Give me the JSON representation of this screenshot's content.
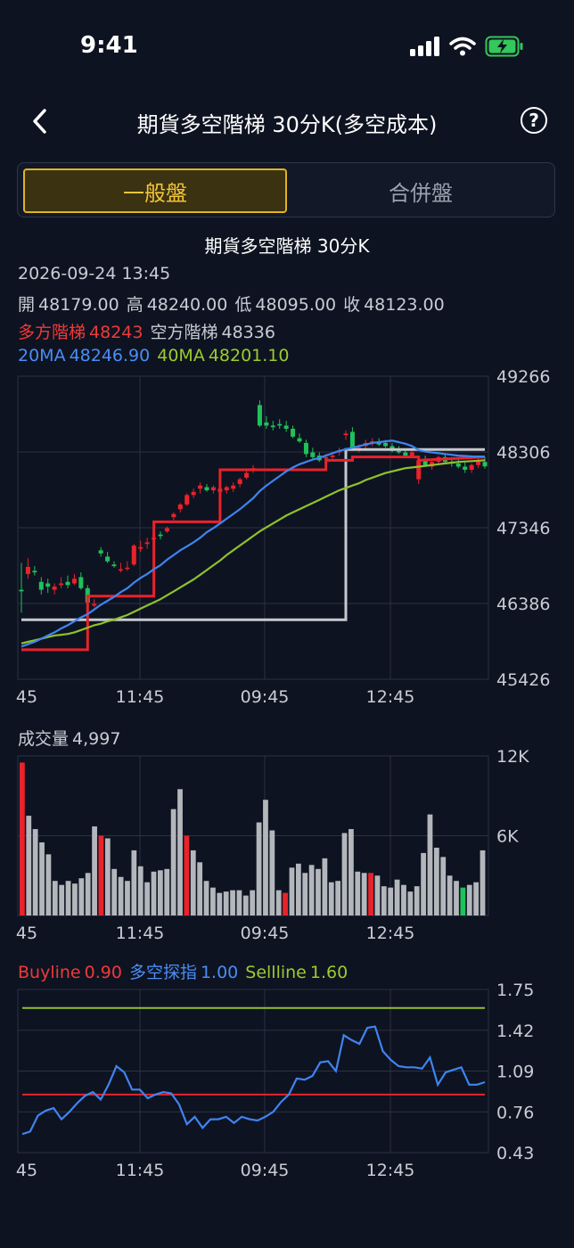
{
  "status": {
    "time": "9:41"
  },
  "nav": {
    "title": "期貨多空階梯 30分K(多空成本)",
    "help": "?"
  },
  "tabs": [
    {
      "label": "一般盤",
      "active": true
    },
    {
      "label": "合併盤",
      "active": false
    }
  ],
  "chart_title": "期貨多空階梯 30分K",
  "info": {
    "datetime": "2026-09-24 13:45",
    "open_label": "開",
    "open": "48179.00",
    "high_label": "高",
    "high": "48240.00",
    "low_label": "低",
    "low": "48095.00",
    "close_label": "收",
    "close": "48123.00",
    "long_label": "多方階梯",
    "long": "48243",
    "short_label": "空方階梯",
    "short": "48336",
    "ma20_label": "20MA",
    "ma20": "48246.90",
    "ma40_label": "40MA",
    "ma40": "48201.10"
  },
  "volume_info": {
    "label": "成交量",
    "value": "4,997"
  },
  "indicator_info": {
    "buy_label": "Buyline",
    "buy": "0.90",
    "idx_label": "多空探指",
    "idx": "1.00",
    "sell_label": "Sellline",
    "sell": "1.60"
  },
  "colors": {
    "up": "#e8232b",
    "down": "#1fc25a",
    "long": "#e8232b",
    "short": "#c6c9ce",
    "ma20": "#3f84f0",
    "ma40": "#8fc12c",
    "grid": "#2b3242"
  },
  "chart_data": [
    {
      "type": "candlestick",
      "y_ticks": [
        "49266",
        "48306",
        "47346",
        "46386",
        "45426"
      ],
      "ylim": [
        45426,
        49266
      ],
      "x_ticks": [
        "45",
        "11:45",
        "09:45",
        "12:45"
      ],
      "candles": [
        [
          46560,
          46900,
          46270,
          46540
        ],
        [
          46760,
          46960,
          46700,
          46850
        ],
        [
          46800,
          46860,
          46740,
          46780
        ],
        [
          46660,
          46720,
          46500,
          46560
        ],
        [
          46640,
          46700,
          46520,
          46600
        ],
        [
          46560,
          46640,
          46500,
          46600
        ],
        [
          46620,
          46720,
          46580,
          46640
        ],
        [
          46660,
          46740,
          46580,
          46620
        ],
        [
          46640,
          46760,
          46620,
          46700
        ],
        [
          46720,
          46780,
          46560,
          46580
        ],
        [
          46580,
          46620,
          46380,
          46400
        ],
        [
          46360,
          46440,
          46340,
          46380
        ],
        [
          47060,
          47100,
          46980,
          47020
        ],
        [
          46980,
          47040,
          46900,
          46920
        ],
        [
          46880,
          46920,
          46840,
          46860
        ],
        [
          46820,
          46900,
          46780,
          46820
        ],
        [
          46840,
          46920,
          46800,
          46840
        ],
        [
          46880,
          47140,
          46860,
          47120
        ],
        [
          47080,
          47180,
          47040,
          47100
        ],
        [
          47140,
          47220,
          47080,
          47160
        ],
        [
          47200,
          47250,
          47180,
          47220
        ],
        [
          47260,
          47300,
          47200,
          47240
        ],
        [
          47300,
          47360,
          47280,
          47340
        ],
        [
          47480,
          47540,
          47440,
          47520
        ],
        [
          47580,
          47660,
          47540,
          47640
        ],
        [
          47640,
          47780,
          47620,
          47760
        ],
        [
          47760,
          47840,
          47720,
          47800
        ],
        [
          47840,
          47920,
          47780,
          47880
        ],
        [
          47860,
          47900,
          47800,
          47820
        ],
        [
          47820,
          47880,
          47780,
          47860
        ],
        [
          47800,
          47860,
          47760,
          47840
        ],
        [
          47820,
          47880,
          47780,
          47860
        ],
        [
          47840,
          47920,
          47800,
          47880
        ],
        [
          47900,
          47980,
          47860,
          47960
        ],
        [
          47980,
          48080,
          47960,
          48040
        ],
        [
          48080,
          48140,
          48040,
          48100
        ],
        [
          48900,
          48960,
          48620,
          48640
        ],
        [
          48680,
          48760,
          48600,
          48640
        ],
        [
          48640,
          48700,
          48580,
          48620
        ],
        [
          48660,
          48720,
          48600,
          48640
        ],
        [
          48640,
          48700,
          48560,
          48600
        ],
        [
          48600,
          48640,
          48480,
          48500
        ],
        [
          48480,
          48540,
          48420,
          48440
        ],
        [
          48420,
          48460,
          48240,
          48280
        ],
        [
          48300,
          48360,
          48220,
          48240
        ],
        [
          48260,
          48300,
          48180,
          48200
        ],
        [
          48220,
          48280,
          48180,
          48240
        ],
        [
          48240,
          48300,
          48200,
          48260
        ],
        [
          48300,
          48360,
          48260,
          48320
        ],
        [
          48520,
          48580,
          48460,
          48540
        ],
        [
          48560,
          48620,
          48320,
          48340
        ],
        [
          48340,
          48400,
          48300,
          48360
        ],
        [
          48380,
          48460,
          48340,
          48420
        ],
        [
          48420,
          48480,
          48380,
          48440
        ],
        [
          48440,
          48480,
          48380,
          48400
        ],
        [
          48420,
          48460,
          48360,
          48380
        ],
        [
          48380,
          48420,
          48300,
          48320
        ],
        [
          48320,
          48380,
          48280,
          48300
        ],
        [
          48300,
          48340,
          48240,
          48260
        ],
        [
          48260,
          48320,
          48240,
          48300
        ],
        [
          47960,
          48220,
          47900,
          48200
        ],
        [
          48200,
          48260,
          48120,
          48140
        ],
        [
          48120,
          48200,
          48080,
          48180
        ],
        [
          48180,
          48260,
          48140,
          48240
        ],
        [
          48240,
          48280,
          48160,
          48180
        ],
        [
          48180,
          48240,
          48120,
          48160
        ],
        [
          48160,
          48220,
          48100,
          48120
        ],
        [
          48120,
          48180,
          48040,
          48080
        ],
        [
          48080,
          48160,
          48040,
          48140
        ],
        [
          48140,
          48220,
          48100,
          48200
        ],
        [
          48180,
          48240,
          48095,
          48123
        ]
      ],
      "long_ladder": [
        [
          0,
          45800
        ],
        [
          10,
          45800
        ],
        [
          10,
          46480
        ],
        [
          20,
          46480
        ],
        [
          20,
          47420
        ],
        [
          30,
          47420
        ],
        [
          30,
          48080
        ],
        [
          40,
          48080
        ],
        [
          40,
          48080
        ],
        [
          46,
          48080
        ],
        [
          46,
          48200
        ],
        [
          50,
          48200
        ],
        [
          50,
          48243
        ],
        [
          60,
          48243
        ],
        [
          60,
          48200
        ],
        [
          70,
          48243
        ]
      ],
      "short_ladder": [
        [
          0,
          46180
        ],
        [
          49,
          46180
        ],
        [
          49,
          48336
        ],
        [
          70,
          48336
        ]
      ],
      "ma20": [
        45840,
        45870,
        45900,
        45940,
        45980,
        46020,
        46070,
        46110,
        46160,
        46210,
        46250,
        46310,
        46370,
        46420,
        46470,
        46530,
        46580,
        46650,
        46710,
        46760,
        46820,
        46870,
        46940,
        47000,
        47060,
        47110,
        47160,
        47220,
        47290,
        47340,
        47400,
        47460,
        47520,
        47580,
        47650,
        47720,
        47810,
        47880,
        47940,
        48000,
        48060,
        48110,
        48150,
        48180,
        48210,
        48230,
        48260,
        48290,
        48320,
        48340,
        48360,
        48380,
        48400,
        48420,
        48430,
        48440,
        48450,
        48430,
        48410,
        48380,
        48330,
        48310,
        48300,
        48290,
        48280,
        48270,
        48260,
        48255,
        48250,
        48248,
        48247
      ],
      "ma40": [
        45880,
        45900,
        45920,
        45940,
        45960,
        45980,
        45990,
        46000,
        46020,
        46050,
        46080,
        46110,
        46130,
        46160,
        46180,
        46210,
        46240,
        46280,
        46320,
        46360,
        46400,
        46440,
        46490,
        46540,
        46590,
        46640,
        46690,
        46750,
        46810,
        46870,
        46930,
        47000,
        47060,
        47120,
        47180,
        47240,
        47300,
        47350,
        47400,
        47450,
        47500,
        47540,
        47580,
        47620,
        47660,
        47700,
        47740,
        47780,
        47820,
        47850,
        47880,
        47910,
        47950,
        47980,
        48010,
        48040,
        48060,
        48080,
        48100,
        48110,
        48120,
        48130,
        48140,
        48150,
        48160,
        48170,
        48180,
        48185,
        48190,
        48195,
        48201
      ]
    },
    {
      "type": "bar",
      "title": "成交量",
      "y_ticks": [
        "12K",
        "6K"
      ],
      "ylim": [
        0,
        12000
      ],
      "x_ticks": [
        "45",
        "11:45",
        "09:45",
        "12:45"
      ],
      "values": [
        11500,
        7500,
        6500,
        5500,
        4600,
        2600,
        2300,
        2600,
        2400,
        2800,
        3200,
        6700,
        6000,
        5800,
        3500,
        2900,
        2600,
        4900,
        3700,
        2500,
        3300,
        3400,
        3500,
        8000,
        9500,
        6000,
        4900,
        4000,
        2600,
        2100,
        1700,
        1800,
        1900,
        1900,
        1500,
        1900,
        7000,
        8700,
        6400,
        1900,
        1700,
        3600,
        3900,
        3200,
        3800,
        3500,
        4300,
        2500,
        2600,
        6200,
        6500,
        3300,
        3200,
        3200,
        3000,
        2200,
        2100,
        2700,
        2300,
        1800,
        2200,
        4700,
        7600,
        5100,
        4400,
        3000,
        2600,
        2100,
        2300,
        2500,
        4900
      ],
      "colors_idx": {
        "0": "up",
        "12": "up",
        "25": "up",
        "40": "up",
        "53": "up",
        "67": "down"
      }
    },
    {
      "type": "line",
      "title": "多空探指",
      "y_ticks": [
        "1.75",
        "1.42",
        "1.09",
        "0.76",
        "0.43"
      ],
      "ylim": [
        0.43,
        1.75
      ],
      "x_ticks": [
        "45",
        "11:45",
        "09:45",
        "12:45"
      ],
      "buyline": 0.9,
      "sellline": 1.6,
      "values": [
        0.58,
        0.6,
        0.73,
        0.77,
        0.79,
        0.7,
        0.76,
        0.83,
        0.89,
        0.92,
        0.86,
        0.98,
        1.13,
        1.08,
        0.94,
        0.94,
        0.87,
        0.9,
        0.92,
        0.91,
        0.82,
        0.66,
        0.72,
        0.63,
        0.7,
        0.7,
        0.72,
        0.67,
        0.72,
        0.7,
        0.69,
        0.72,
        0.76,
        0.84,
        0.9,
        1.03,
        1.02,
        1.05,
        1.16,
        1.17,
        1.09,
        1.38,
        1.34,
        1.31,
        1.44,
        1.45,
        1.25,
        1.18,
        1.13,
        1.12,
        1.12,
        1.11,
        1.2,
        0.98,
        1.08,
        1.1,
        1.12,
        0.98,
        0.98,
        1.0
      ]
    }
  ]
}
